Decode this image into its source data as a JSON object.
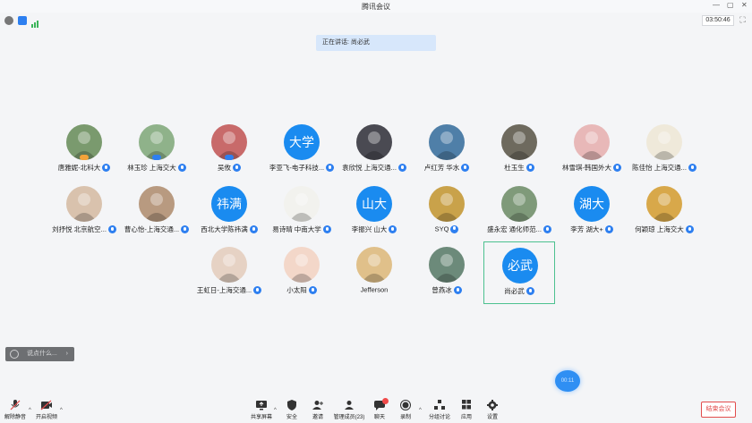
{
  "window": {
    "title": "腾讯会议",
    "minimize": "—",
    "maximize": "▢",
    "close": "✕"
  },
  "status": {
    "timer": "03:50:46",
    "fullscreen": "⛶"
  },
  "speaking": {
    "text": "正在讲话: 尚必武"
  },
  "participants": [
    {
      "name": "唐雅妮-北科大",
      "avatar": "photo",
      "bg": "#7a9a6e",
      "host": true
    },
    {
      "name": "林玉珍 上海交大",
      "avatar": "photo",
      "bg": "#8fb28a",
      "host": true
    },
    {
      "name": "吴攸",
      "avatar": "photo",
      "bg": "#c86a6a",
      "host": true
    },
    {
      "name": "李亚飞-电子科技...",
      "avatar": "text",
      "initials": "大学"
    },
    {
      "name": "袁欣悦 上海交通...",
      "avatar": "photo",
      "bg": "#4a4a52"
    },
    {
      "name": "卢红芳 华水",
      "avatar": "photo",
      "bg": "#4f7fa8"
    },
    {
      "name": "杜玉生",
      "avatar": "photo",
      "bg": "#6e6a5e"
    },
    {
      "name": "林雪琪-韩国外大",
      "avatar": "photo",
      "bg": "#e8b8b8"
    },
    {
      "name": "陈佳怡 上海交通...",
      "avatar": "photo",
      "bg": "#efe9da"
    },
    {
      "name": "刘抒悦 北京航空...",
      "avatar": "photo",
      "bg": "#d9c2ad"
    },
    {
      "name": "曹心怡-上海交通...",
      "avatar": "photo",
      "bg": "#b89a80"
    },
    {
      "name": "西北大学陈祎满",
      "avatar": "text",
      "initials": "祎满"
    },
    {
      "name": "易诗晴 中南大学",
      "avatar": "photo",
      "bg": "#f2f2ee"
    },
    {
      "name": "李振兴 山大",
      "avatar": "text",
      "initials": "山大"
    },
    {
      "name": "SYQ",
      "avatar": "photo",
      "bg": "#c9a24a"
    },
    {
      "name": "盛永宏 通化师范...",
      "avatar": "photo",
      "bg": "#7f9a7a"
    },
    {
      "name": "李芳 湖大+",
      "avatar": "text",
      "initials": "湖大"
    },
    {
      "name": "何颖琼 上海交大",
      "avatar": "photo",
      "bg": "#d8a84a"
    },
    {
      "name": "王虹日-上海交通...",
      "avatar": "photo",
      "bg": "#e6d2c4"
    },
    {
      "name": "小太阳",
      "avatar": "photo",
      "bg": "#f3d7c9"
    },
    {
      "name": "Jefferson",
      "avatar": "photo",
      "bg": "#e0c08a",
      "mic": false
    },
    {
      "name": "曾燕冰",
      "avatar": "photo",
      "bg": "#6c8a7a"
    },
    {
      "name": "尚必武",
      "avatar": "text",
      "initials": "必武",
      "active": true
    }
  ],
  "chat": {
    "placeholder": "说点什么...",
    "arrow": "›"
  },
  "floating": {
    "text": "00:11"
  },
  "toolbar": {
    "unmute": "解除静音",
    "video": "开启视频",
    "share": "共享屏幕",
    "security": "安全",
    "invite": "邀请",
    "members": "管理成员(23)",
    "chat": "聊天",
    "record": "录制",
    "breakout": "分组讨论",
    "apps": "应用",
    "settings": "设置",
    "end": "结束会议"
  }
}
